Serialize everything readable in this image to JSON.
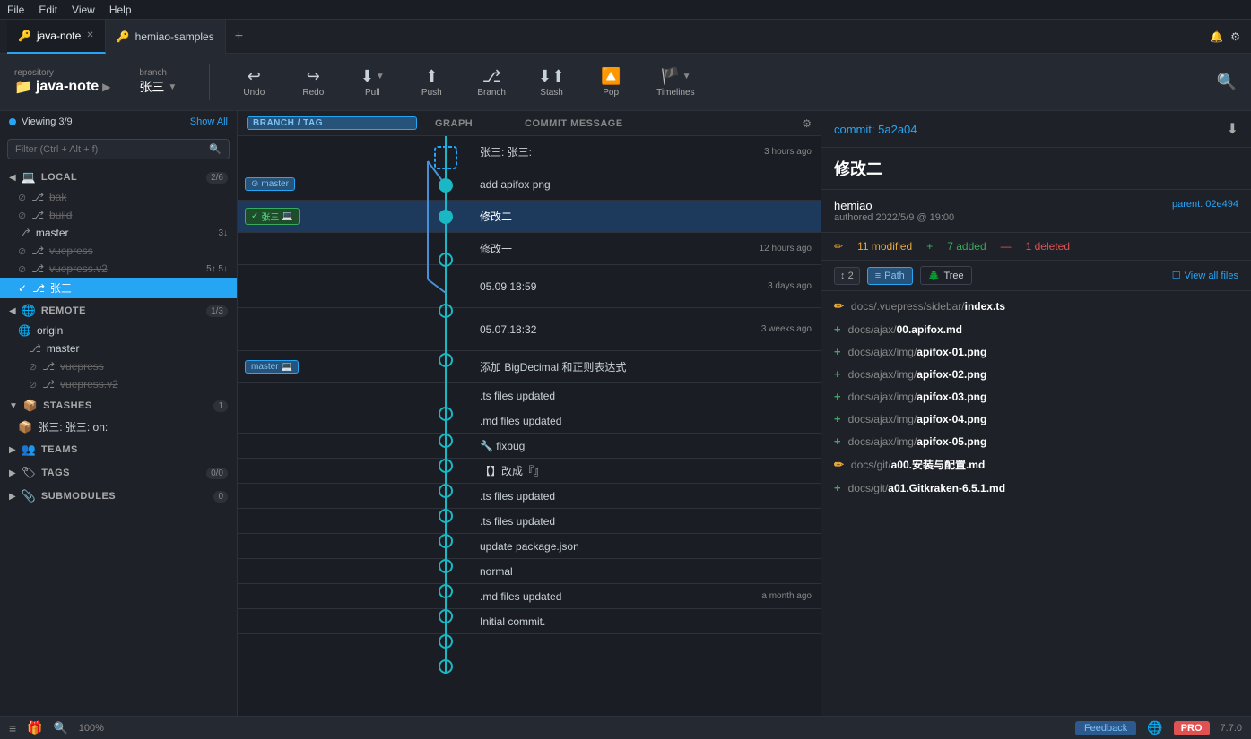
{
  "menuBar": {
    "items": [
      "File",
      "Edit",
      "View",
      "Help"
    ]
  },
  "tabs": {
    "active": "java-note",
    "items": [
      {
        "label": "java-note",
        "icon": "🔑",
        "active": true
      },
      {
        "label": "hemiao-samples",
        "icon": "🔑",
        "active": false
      }
    ],
    "add_label": "+",
    "notification_icon": "🔔",
    "settings_icon": "⚙"
  },
  "toolbar": {
    "repo_label": "repository",
    "repo_name": "java-note",
    "branch_label": "branch",
    "branch_name": "张三",
    "undo_label": "Undo",
    "redo_label": "Redo",
    "pull_label": "Pull",
    "push_label": "Push",
    "branch_btn_label": "Branch",
    "stash_label": "Stash",
    "pop_label": "Pop",
    "timelines_label": "Timelines",
    "search_icon": "🔍"
  },
  "sidebar": {
    "viewing": "Viewing 3/9",
    "show_all": "Show All",
    "filter_placeholder": "Filter (Ctrl + Alt + f)",
    "local": {
      "title": "LOCAL",
      "count": "2/6",
      "branches": [
        {
          "name": "bak",
          "strikethrough": true,
          "icon": "⊘"
        },
        {
          "name": "build",
          "strikethrough": true,
          "icon": "⊘"
        },
        {
          "name": "master",
          "count": "3↓"
        },
        {
          "name": "vuepress",
          "strikethrough": true,
          "icon": "⊘"
        },
        {
          "name": "vuepress.v2",
          "count": "5↑ 5↓",
          "strikethrough": false,
          "icon": "⊘"
        },
        {
          "name": "张三",
          "active": true
        }
      ]
    },
    "remote": {
      "title": "REMOTE",
      "count": "1/3",
      "items": [
        {
          "name": "origin",
          "type": "globe"
        },
        {
          "name": "master",
          "indent": true
        },
        {
          "name": "vuepress",
          "strikethrough": true,
          "indent": true,
          "icon": "⊘"
        },
        {
          "name": "vuepress.v2",
          "strikethrough": true,
          "indent": true,
          "icon": "⊘"
        }
      ]
    },
    "stashes": {
      "title": "STASHES",
      "count": "1",
      "items": [
        {
          "name": "张三: 张三: on:"
        }
      ]
    },
    "teams": {
      "title": "TEAMS"
    },
    "tags": {
      "title": "TAGS",
      "count": "0/0"
    },
    "submodules": {
      "title": "SUBMODULES",
      "count": "0"
    }
  },
  "commitGraph": {
    "headers": {
      "branch_tag": "BRANCH / TAG",
      "graph": "GRAPH",
      "message": "COMMIT MESSAGE"
    },
    "commits": [
      {
        "branch": "stash",
        "message": "张三: 张三:",
        "time": "3 hours ago",
        "type": "stash"
      },
      {
        "branch": "master",
        "branch_icon": "target",
        "message": "add apifox png",
        "time": "",
        "selected": false
      },
      {
        "branch": "张三",
        "branch_icon": "check-laptop",
        "message": "修改二",
        "time": "",
        "selected": true
      },
      {
        "branch": "",
        "message": "修改一",
        "time": "12 hours ago"
      },
      {
        "branch": "",
        "message": "05.09 18:59",
        "time": "3 days ago"
      },
      {
        "branch": "",
        "message": "05.07.18:32",
        "time": "3 weeks ago"
      },
      {
        "branch": "master",
        "branch_icon": "laptop",
        "message": "添加 BigDecimal 和正则表达式",
        "time": ""
      },
      {
        "branch": "",
        "message": ".ts files updated",
        "time": ""
      },
      {
        "branch": "",
        "message": ".md files updated",
        "time": ""
      },
      {
        "branch": "",
        "message": "🔧 fixbug",
        "time": ""
      },
      {
        "branch": "",
        "message": "【】改成『』",
        "time": ""
      },
      {
        "branch": "",
        "message": ".ts files updated",
        "time": ""
      },
      {
        "branch": "",
        "message": ".ts files updated",
        "time": ""
      },
      {
        "branch": "",
        "message": "update package.json",
        "time": ""
      },
      {
        "branch": "",
        "message": "normal",
        "time": ""
      },
      {
        "branch": "",
        "message": ".md files updated",
        "time": "a month ago"
      },
      {
        "branch": "",
        "message": "Initial commit.",
        "time": ""
      }
    ]
  },
  "detailPanel": {
    "commit_id_label": "commit: ",
    "commit_id": "5a2a04",
    "message": "修改二",
    "author": "hemiao",
    "authored_label": "authored",
    "authored_date": "2022/5/9 @ 19:00",
    "parent_label": "parent: ",
    "parent_id": "02e494",
    "stats": {
      "modified": "11 modified",
      "added": "7 added",
      "deleted": "1 deleted"
    },
    "view_controls": {
      "sort_icon": "↕",
      "sort_num": "2",
      "path_label": "Path",
      "tree_label": "Tree",
      "view_all_label": "View all files"
    },
    "files": [
      {
        "status": "modified",
        "path": "docs/.vuepress/sidebar/",
        "name": "index.ts"
      },
      {
        "status": "added",
        "path": "docs/ajax/",
        "name": "00.apifox.md"
      },
      {
        "status": "added",
        "path": "docs/ajax/img/",
        "name": "apifox-01.png"
      },
      {
        "status": "added",
        "path": "docs/ajax/img/",
        "name": "apifox-02.png"
      },
      {
        "status": "added",
        "path": "docs/ajax/img/",
        "name": "apifox-03.png"
      },
      {
        "status": "added",
        "path": "docs/ajax/img/",
        "name": "apifox-04.png"
      },
      {
        "status": "added",
        "path": "docs/ajax/img/",
        "name": "apifox-05.png"
      },
      {
        "status": "modified",
        "path": "docs/git/",
        "name": "a00.安装与配置.md"
      },
      {
        "status": "added",
        "path": "docs/git/",
        "name": "a01.Gitkraken-6.5.1.md"
      }
    ]
  },
  "statusBar": {
    "zoom": "100%",
    "feedback": "Feedback",
    "pro_label": "PRO",
    "version": "7.7.0"
  }
}
